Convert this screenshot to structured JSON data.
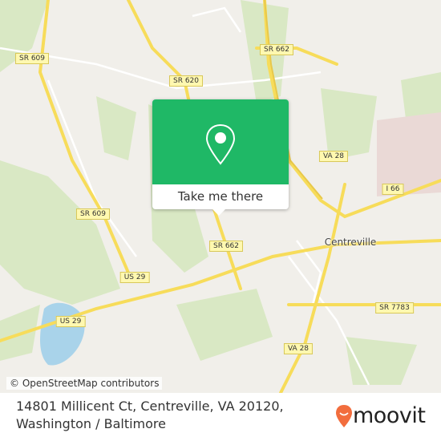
{
  "map": {
    "road_labels": [
      "SR 609",
      "SR 620",
      "SR 662",
      "VA 28",
      "I 66",
      "SR 609",
      "SR 662",
      "US 29",
      "US 29",
      "SR 7783",
      "VA 28"
    ],
    "places": [
      "Centreville"
    ],
    "attribution": "© OpenStreetMap contributors",
    "colors": {
      "background": "#f1efea",
      "park": "#d9e8c4",
      "road": "#f7dc5a",
      "water": "#a9d3ea"
    }
  },
  "popup": {
    "icon": "location-pin-icon",
    "action_label": "Take me there",
    "color": "#1fb866"
  },
  "footer": {
    "address_line1": "14801 Millicent Ct, Centreville, VA 20120,",
    "address_line2": "Washington / Baltimore",
    "brand": "moovit",
    "brand_color": "#f26d3d"
  }
}
